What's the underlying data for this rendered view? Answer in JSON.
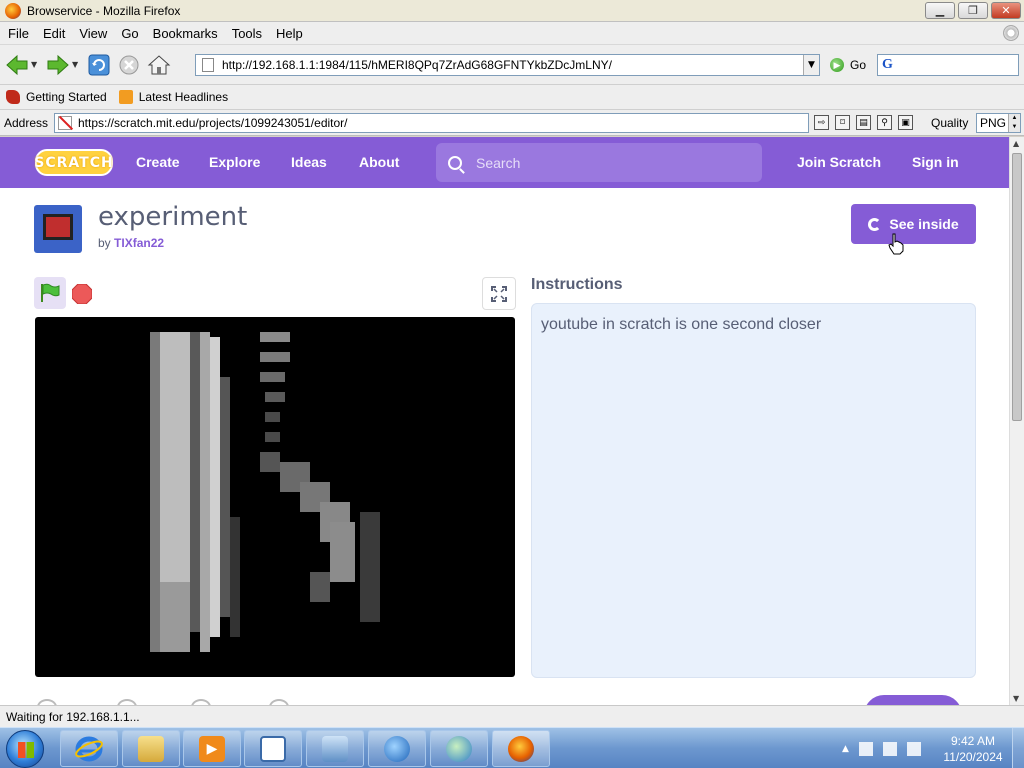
{
  "window": {
    "title": "Browservice - Mozilla Firefox",
    "minimize_label": "▁",
    "maximize_label": "❐",
    "close_label": "✕"
  },
  "menu": [
    "File",
    "Edit",
    "View",
    "Go",
    "Bookmarks",
    "Tools",
    "Help"
  ],
  "navigation": {
    "url": "http://192.168.1.1:1984/115/hMERI8QPq7ZrAdG68GFNTYkbZDcJmLNY/",
    "go_label": "Go"
  },
  "bookmarks": [
    {
      "label": "Getting Started",
      "icon": "firefox-bookmark-icon"
    },
    {
      "label": "Latest Headlines",
      "icon": "rss-icon"
    }
  ],
  "address_bar": {
    "label": "Address",
    "url": "https://scratch.mit.edu/projects/1099243051/editor/",
    "quality_label": "Quality",
    "quality_value": "PNG"
  },
  "scratch": {
    "logo_text": "SCRATCH",
    "nav": {
      "create": "Create",
      "explore": "Explore",
      "ideas": "Ideas",
      "about": "About",
      "search_placeholder": "Search",
      "join": "Join Scratch",
      "sign_in": "Sign in"
    },
    "project": {
      "title": "experiment",
      "by": "by",
      "author": "TIXfan22",
      "see_inside": "See inside"
    },
    "instructions": {
      "heading": "Instructions",
      "text": "youtube in scratch is one second closer"
    }
  },
  "status": {
    "text": "Waiting for 192.168.1.1..."
  },
  "taskbar": {
    "time": "9:42 AM",
    "date": "11/20/2024"
  },
  "colors": {
    "scratch_purple": "#855cd6",
    "instructions_bg": "#e9f1fc",
    "stage_bg": "#000000"
  }
}
